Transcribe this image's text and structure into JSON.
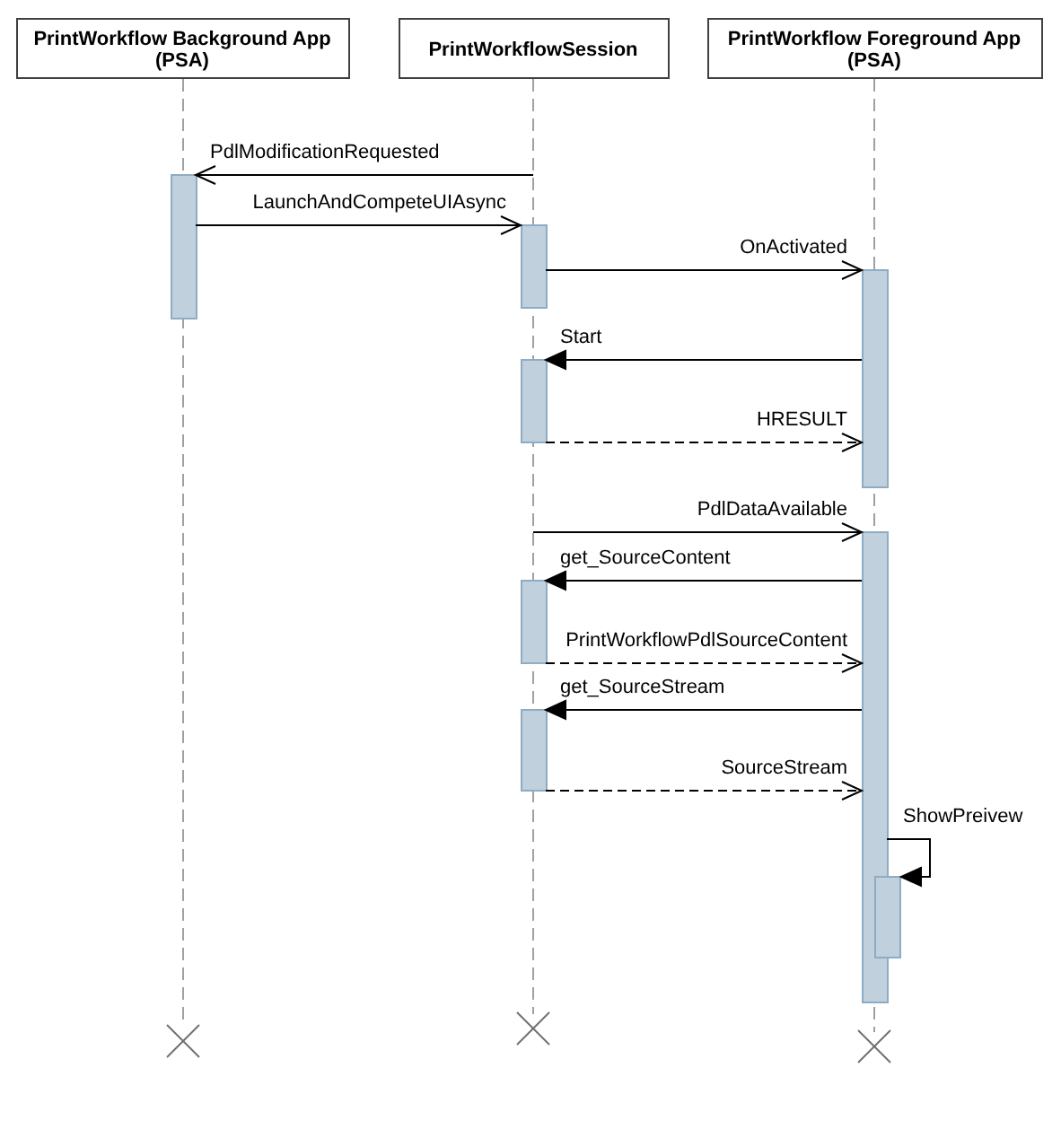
{
  "participants": [
    {
      "lines": [
        "PrintWorkflow Background App",
        "(PSA)"
      ]
    },
    {
      "lines": [
        "PrintWorkflowSession"
      ]
    },
    {
      "lines": [
        "PrintWorkflow Foreground App",
        "(PSA)"
      ]
    }
  ],
  "messages": [
    {
      "label": "PdlModificationRequested",
      "kind": "call"
    },
    {
      "label": "LaunchAndCompeteUIAsync",
      "kind": "call"
    },
    {
      "label": "OnActivated",
      "kind": "call"
    },
    {
      "label": "Start",
      "kind": "sync"
    },
    {
      "label": "HRESULT",
      "kind": "return"
    },
    {
      "label": "PdlDataAvailable",
      "kind": "call"
    },
    {
      "label": "get_SourceContent",
      "kind": "sync"
    },
    {
      "label": "PrintWorkflowPdlSourceContent",
      "kind": "return"
    },
    {
      "label": "get_SourceStream",
      "kind": "sync"
    },
    {
      "label": "SourceStream",
      "kind": "return"
    },
    {
      "label": "ShowPreivew",
      "kind": "self"
    }
  ]
}
